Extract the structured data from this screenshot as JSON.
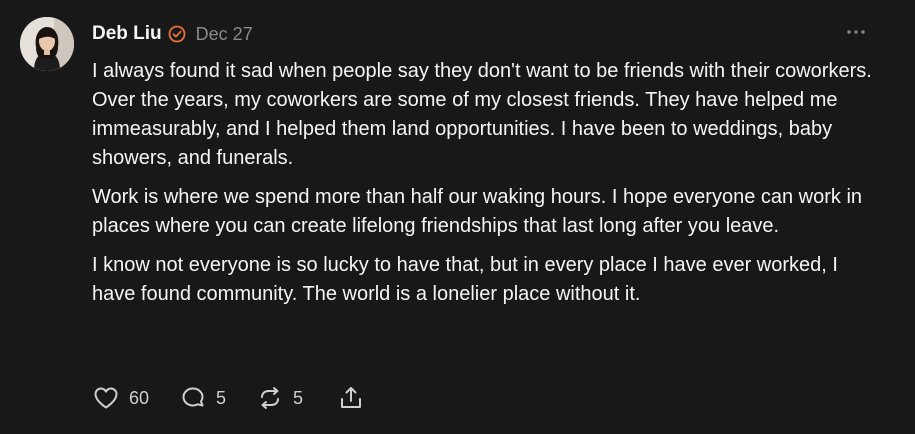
{
  "post": {
    "author": "Deb Liu",
    "date": "Dec 27",
    "verified": true,
    "paragraphs": [
      "I always found it sad when people say they don't want to be friends with their coworkers. Over the years, my coworkers are some of my closest friends. They have helped me immeasurably, and I helped them land opportunities. I have been to weddings, baby showers, and funerals.",
      "Work is where we spend more than half our waking hours. I hope everyone can work in places where you can create lifelong friendships that last long after you leave.",
      "I know not everyone is so lucky to have that, but in every place I have ever worked, I have found community. The world is a lonelier place without it."
    ],
    "stats": {
      "likes": "60",
      "replies": "5",
      "reposts": "5"
    }
  },
  "icons": {
    "verified": "verified-badge-icon",
    "more": "more-options-icon",
    "like": "heart-icon",
    "reply": "comment-icon",
    "repost": "repost-icon",
    "share": "share-icon"
  },
  "colors": {
    "background": "#181818",
    "text": "#f3f5f7",
    "muted": "#8a8a8a",
    "verified": "#e8703a"
  }
}
